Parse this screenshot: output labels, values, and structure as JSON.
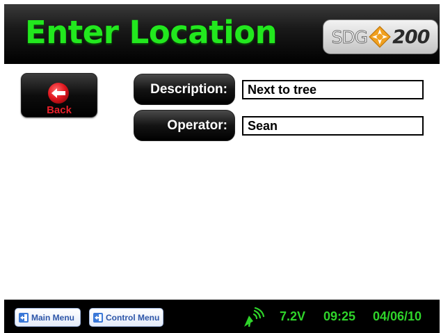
{
  "header": {
    "title": "Enter Location",
    "logo": {
      "brand": "SDG",
      "model": "200",
      "icon": "diamond-compass-icon"
    }
  },
  "back_button": {
    "label": "Back",
    "icon": "back-arrow-icon"
  },
  "fields": {
    "description": {
      "label": "Description:",
      "value": "Next to tree"
    },
    "operator": {
      "label": "Operator:",
      "value": "Sean"
    }
  },
  "footer": {
    "main_menu_label": "Main Menu",
    "control_menu_label": "Control Menu",
    "menu_icon": "exit-door-icon",
    "signal_icon": "satellite-signal-icon",
    "voltage": "7.2V",
    "time": "09:25",
    "date": "04/06/10"
  },
  "colors": {
    "title_green": "#22e81e",
    "status_green": "#2fd42a",
    "back_red": "#e8202a",
    "menu_blue": "#2e56a8",
    "logo_orange": "#f0a020"
  }
}
